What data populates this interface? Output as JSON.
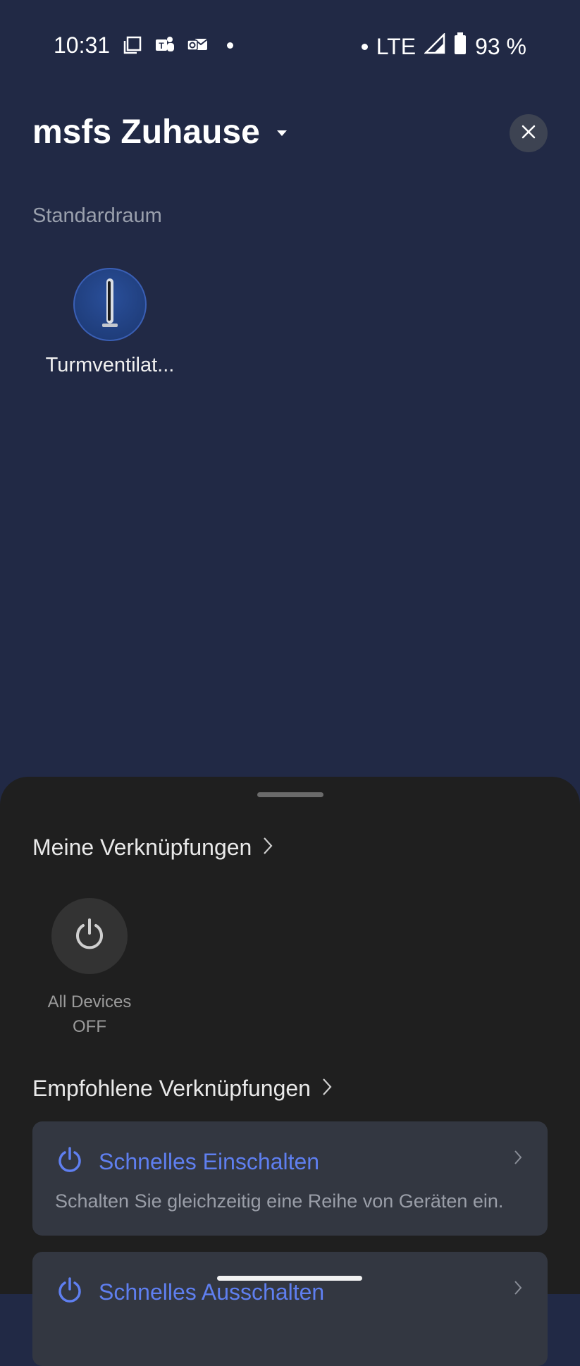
{
  "status_bar": {
    "time": "10:31",
    "network": "LTE",
    "battery": "93 %",
    "icons": [
      "screenshot-icon",
      "teams-icon",
      "outlook-icon",
      "notification-dot",
      "signal-icon",
      "battery-icon"
    ]
  },
  "header": {
    "home_name": "msfs Zuhause",
    "home_selector_icon": "caret-down-icon",
    "close_icon": "close-icon"
  },
  "room": {
    "label": "Standardraum",
    "devices": [
      {
        "name": "Turmventilat...",
        "icon": "tower-fan-icon"
      }
    ]
  },
  "sheet": {
    "my_shortcuts": {
      "title": "Meine Verknüpfungen",
      "items": [
        {
          "label_line1": "All Devices",
          "label_line2": "OFF",
          "icon": "power-icon"
        }
      ]
    },
    "recommended": {
      "title": "Empfohlene Verknüpfungen",
      "cards": [
        {
          "title": "Schnelles Einschalten",
          "description": "Schalten Sie gleichzeitig eine Reihe von Geräten ein.",
          "icon": "power-icon"
        },
        {
          "title": "Schnelles Ausschalten",
          "description": "",
          "icon": "power-icon"
        }
      ]
    }
  },
  "colors": {
    "background": "#212945",
    "sheet": "#1f1f1f",
    "card": "#333741",
    "accent": "#5f7ff0"
  }
}
